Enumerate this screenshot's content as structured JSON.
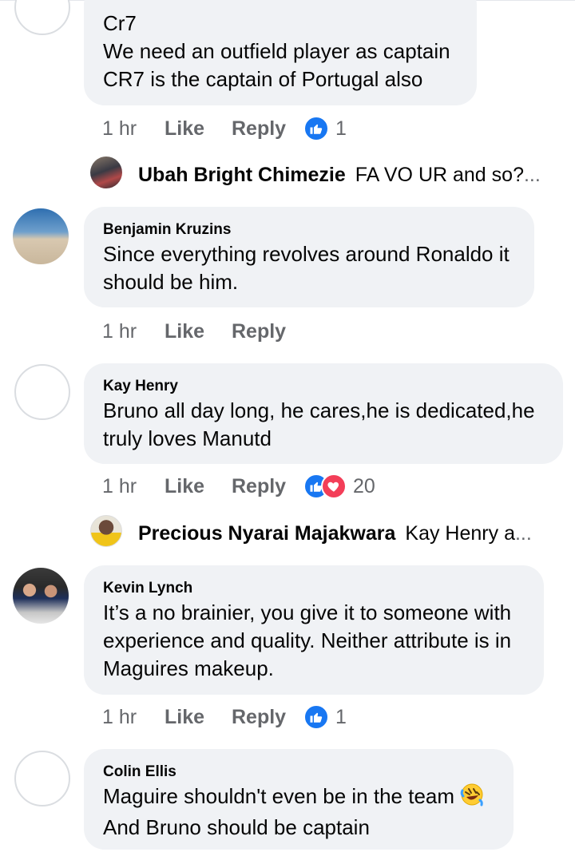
{
  "comments": [
    {
      "name": "",
      "lines": [
        "Cr7",
        "We need an outfield player as captain",
        "CR7 is the captain of Portugal also"
      ],
      "time": "1 hr",
      "like_label": "Like",
      "reply_label": "Reply",
      "reactions": [
        "like"
      ],
      "reaction_count": "1"
    },
    {
      "name": "Benjamin Kruzins",
      "lines": [
        "Since everything revolves around Ronaldo it",
        "should be him."
      ],
      "time": "1 hr",
      "like_label": "Like",
      "reply_label": "Reply"
    },
    {
      "name": "Kay Henry",
      "lines": [
        "Bruno all day long,  he cares,he is dedicated,he",
        "truly loves Manutd"
      ],
      "time": "1 hr",
      "like_label": "Like",
      "reply_label": "Reply",
      "reactions": [
        "like",
        "love"
      ],
      "reaction_count": "20"
    },
    {
      "name": "Kevin Lynch",
      "lines": [
        "It’s a no brainier, you give it to someone with",
        "experience and quality. Neither attribute is in",
        "Maguires makeup."
      ],
      "time": "1 hr",
      "like_label": "Like",
      "reply_label": "Reply",
      "reactions": [
        "like"
      ],
      "reaction_count": "1"
    },
    {
      "name": "Colin Ellis",
      "lines": [
        "Maguire shouldn't even be in the team",
        "And Bruno should be captain"
      ],
      "emoji": "rolling-on-floor-laughing-emoji"
    }
  ],
  "replies": [
    {
      "name": "Ubah Bright Chimezie",
      "text": "FA VO UR and so?",
      "ellipsis": "..."
    },
    {
      "name": "Precious Nyarai Majakwara",
      "text": "Kay Henry a",
      "ellipsis": "..."
    }
  ],
  "colors": {
    "bubble": "#f0f2f5",
    "meta": "#65676b",
    "like_blue": "#1877f2",
    "love_red": "#f33e58"
  }
}
